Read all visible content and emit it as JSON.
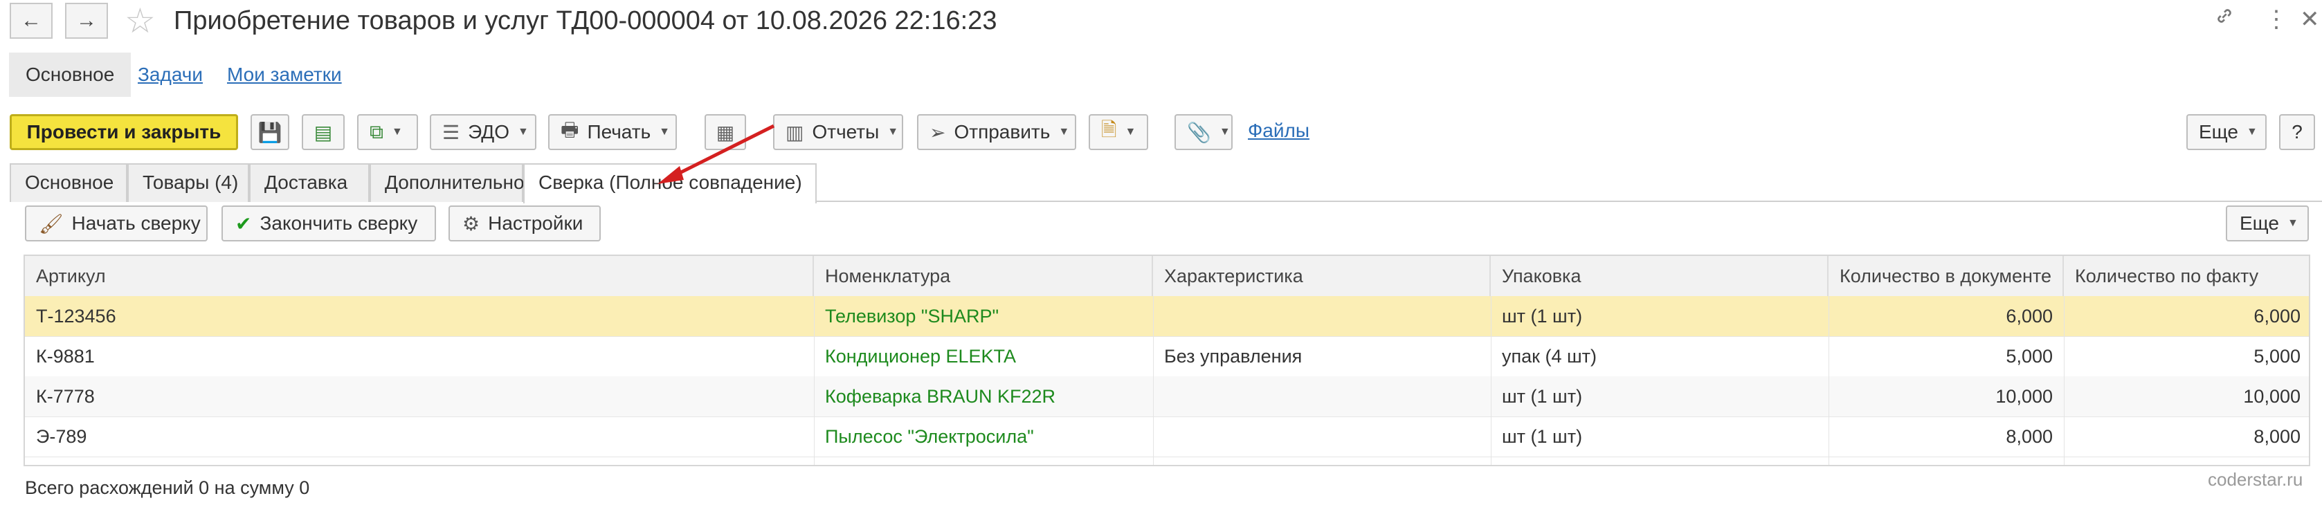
{
  "window": {
    "title": "Приобретение товаров и услуг ТД00-000004 от 10.08.2026 22:16:23",
    "back_icon": "←",
    "forward_icon": "→",
    "star_icon": "☆",
    "link_icon": "🔗",
    "more_icon": "⋮",
    "close_icon": "✕"
  },
  "section_nav": {
    "items": [
      "Основное",
      "Задачи",
      "Мои заметки"
    ]
  },
  "command_bar": {
    "post_close": "Провести и закрыть",
    "edo": "ЭДО",
    "print": "Печать",
    "reports": "Отчеты",
    "send": "Отправить",
    "files": "Файлы",
    "more": "Еще",
    "help": "?"
  },
  "tabs": [
    "Основное",
    "Товары (4)",
    "Доставка",
    "Дополнительно",
    "Сверка (Полное совпадение)"
  ],
  "reconcile_bar": {
    "start": "Начать сверку",
    "finish": "Закончить сверку",
    "settings": "Настройки",
    "more": "Еще"
  },
  "table": {
    "columns": [
      "Артикул",
      "Номенклатура",
      "Характеристика",
      "Упаковка",
      "Количество в документе",
      "Количество по факту"
    ],
    "rows": [
      {
        "article": "Т-123456",
        "item": "Телевизор \"SHARP\"",
        "characteristic": "",
        "pack": "шт (1 шт)",
        "qty_doc": "6,000",
        "qty_fact": "6,000"
      },
      {
        "article": "К-9881",
        "item": "Кондиционер ELEKTA",
        "characteristic": "Без управления",
        "pack": "упак (4 шт)",
        "qty_doc": "5,000",
        "qty_fact": "5,000"
      },
      {
        "article": "К-7778",
        "item": "Кофеварка BRAUN KF22R",
        "characteristic": "",
        "pack": "шт (1 шт)",
        "qty_doc": "10,000",
        "qty_fact": "10,000"
      },
      {
        "article": "Э-789",
        "item": "Пылесос \"Электросила\"",
        "characteristic": "",
        "pack": "шт (1 шт)",
        "qty_doc": "8,000",
        "qty_fact": "8,000"
      }
    ]
  },
  "summary": "Всего расхождений 0 на сумму 0",
  "watermark": "coderstar.ru",
  "colors": {
    "primary_button": "#f5e33e",
    "selected_row": "#fbeeb5",
    "link": "#2b6eb8",
    "item_text": "#1d8a1d",
    "arrow": "#d42020"
  }
}
